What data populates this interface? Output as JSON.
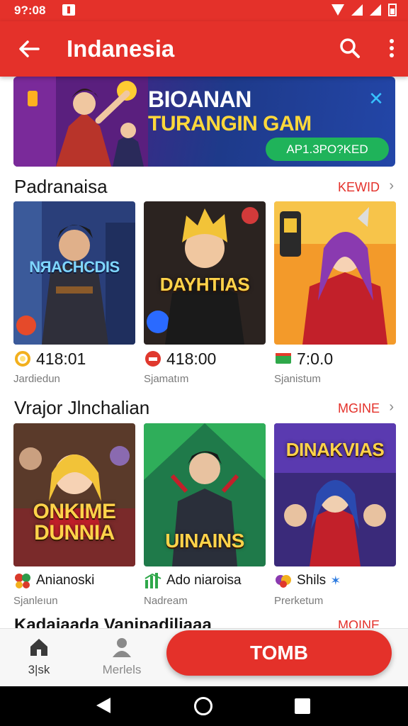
{
  "status": {
    "time": "9?:08"
  },
  "appbar": {
    "title": "Indanesia"
  },
  "banner": {
    "line1": "BIOANAN",
    "line2": "TURANGIN GAM",
    "cta": "AP1.3PO?KED"
  },
  "sections": [
    {
      "title": "Padranaisa",
      "more": "KEWID",
      "cards": [
        {
          "overlay": "NЯACHCDIS",
          "stat": "418:01",
          "stat_icon": "sun-coin-icon",
          "sub": "Jardiedun"
        },
        {
          "overlay": "DAYHTIAS",
          "stat": "418:00",
          "stat_icon": "red-coin-icon",
          "sub": "Sjamatım"
        },
        {
          "overlay": "",
          "stat": "7:0.0",
          "stat_icon": "cash-icon",
          "sub": "Sjanistum"
        }
      ]
    },
    {
      "title": "Vrajor Jlnchalian",
      "more": "MGINE",
      "cards": [
        {
          "overlay": "ONKIME DUNNIA",
          "stat": "Anianoski",
          "stat_icon": "butterfly-icon",
          "sub": "Sjanleıun"
        },
        {
          "overlay": "UINAINS",
          "stat": "Ado niaroisa",
          "stat_icon": "green-chart-icon",
          "sub": "Nadream"
        },
        {
          "overlay": "DINAKVIAS",
          "stat": "Shils",
          "stat_icon": "colorful-mask-icon",
          "sub": "Prerketum"
        }
      ]
    }
  ],
  "next_section": {
    "title": "Kadaiaada Vanipadiliaaa",
    "more": "MOINE"
  },
  "bottom_nav": {
    "home_label": "3|sk",
    "profile_label": "Merlels",
    "cta": "TOMB"
  },
  "colors": {
    "brand_red": "#e4312a",
    "cta_green": "#1fb35a",
    "title_yellow": "#ffd83a"
  }
}
